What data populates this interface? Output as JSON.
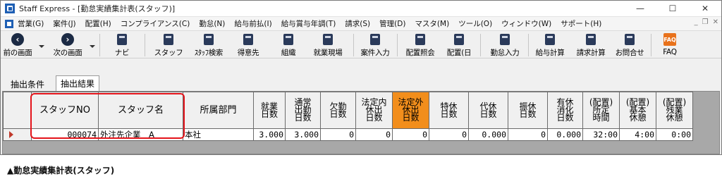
{
  "window": {
    "title": "Staff Express - [勤怠実績集計表(スタッフ)]",
    "controls": {
      "minimize": "—",
      "maximize": "☐",
      "close": "✕"
    }
  },
  "menu": {
    "items": [
      "営業(G)",
      "案件(J)",
      "配置(H)",
      "コンプライアンス(C)",
      "勤怠(N)",
      "給与前払(I)",
      "給与賞与年調(T)",
      "請求(S)",
      "管理(D)",
      "マスタ(M)",
      "ツール(O)",
      "ウィンドウ(W)",
      "サポート(H)"
    ],
    "mdi_controls": {
      "minimize": "_",
      "restore": "❐",
      "close": "✕"
    }
  },
  "toolbar": {
    "prev_screen": {
      "label": "前の画面",
      "icon": "back-circle-icon"
    },
    "next_screen": {
      "label": "次の画面",
      "icon": "forward-circle-icon"
    },
    "navi": {
      "label": "ナビ",
      "icon": "keyboard-icon"
    },
    "staff": {
      "label": "スタッフ",
      "icon": "staff-icon"
    },
    "staff_search": {
      "label": "ｽﾀｯﾌ検索",
      "icon": "staff-search-icon"
    },
    "customer": {
      "label": "得意先",
      "icon": "customer-icon"
    },
    "organization": {
      "label": "組織",
      "icon": "organization-icon"
    },
    "worksite": {
      "label": "就業現場",
      "icon": "worksite-icon"
    },
    "case_input": {
      "label": "案件入力",
      "icon": "case-input-icon"
    },
    "placement_inquiry": {
      "label": "配置照会",
      "icon": "placement-inquiry-icon"
    },
    "placement_day": {
      "label": "配置(日",
      "icon": "placement-day-icon"
    },
    "attendance_input": {
      "label": "勤怠入力",
      "icon": "attendance-input-icon"
    },
    "payroll_calc": {
      "label": "給与計算",
      "icon": "payroll-calc-icon"
    },
    "invoice_calc": {
      "label": "請求計算",
      "icon": "invoice-calc-icon"
    },
    "inquiry": {
      "label": "お問合せ",
      "icon": "inquiry-icon"
    },
    "faq": {
      "label": "FAQ",
      "icon_text": "FAQ"
    }
  },
  "tabs": [
    {
      "label": "抽出条件",
      "active": false
    },
    {
      "label": "抽出結果",
      "active": true
    }
  ],
  "grid": {
    "headers": [
      "スタッフNO",
      "スタッフ名",
      "所属部門",
      "就業\n日数",
      "通常\n出勤\n日数",
      "欠勤\n日数",
      "法定内\n休出\n日数",
      "法定外\n休出\n日数",
      "特休\n日数",
      "代休\n日数",
      "振休\n日数",
      "有休\n消化\n日数",
      "(配置)\n所定\n時間",
      "(配置)\n基本\n休憩",
      "(配置)\n残業\n休憩"
    ],
    "highlighted_column": "法定外\n休出\n日数",
    "rows": [
      {
        "staff_no": "000074",
        "staff_name": "外注先企業　A",
        "department": "本社",
        "work_days": "3.000",
        "normal_days": "3.000",
        "absence_days": "0",
        "legal_holiday_work": "0",
        "nonlegal_holiday_work": "0",
        "special_leave": "0",
        "compensatory_leave": "0.000",
        "substitute_leave": "0",
        "paid_leave": "0.000",
        "scheduled_hours": "32:00",
        "basic_break": "4:00",
        "overtime_break": "0:00"
      }
    ],
    "colors": {
      "highlight_header": "#f28e1c",
      "annotation_box": "#e4141b"
    }
  },
  "caption": "▲勤怠実績集計表(スタッフ)"
}
